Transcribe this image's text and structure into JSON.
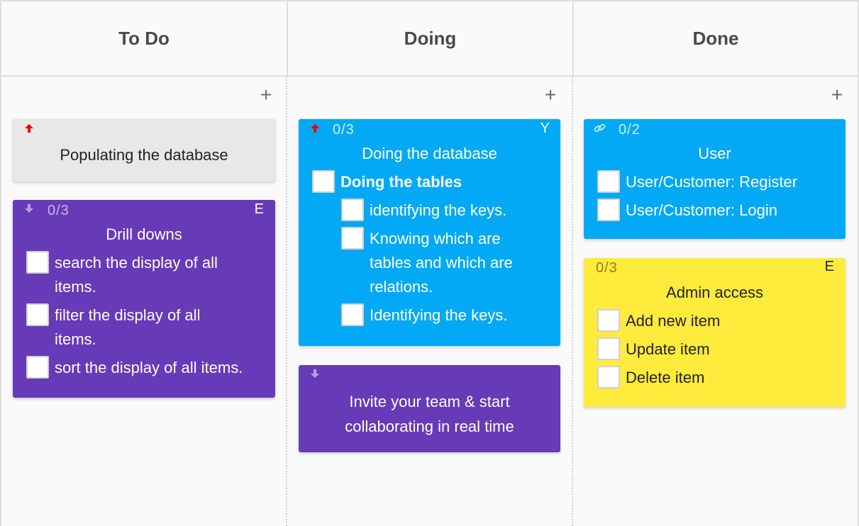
{
  "columns": [
    {
      "title": "To Do",
      "add_label": "+"
    },
    {
      "title": "Doing",
      "add_label": "+"
    },
    {
      "title": "Done",
      "add_label": "+"
    }
  ],
  "cards": {
    "populating": {
      "title": "Populating the database",
      "priority": "high",
      "color": "#e8e8e8"
    },
    "drill": {
      "counter": "0/3",
      "initial": "E",
      "title": "Drill downs",
      "priority": "low",
      "color": "#673ab7",
      "items": [
        "search the display of all items.",
        "filter the display of all items.",
        "sort the display of all items."
      ]
    },
    "doing_db": {
      "counter": "0/3",
      "initial": "Y",
      "title": "Doing the database",
      "priority": "high",
      "color": "#03a9f4",
      "parent_item": "Doing the tables",
      "items": [
        "identifying the keys.",
        "Knowing which are tables and which are relations.",
        "Identifying the keys."
      ]
    },
    "invite": {
      "title": "Invite your team & start collaborating in real time",
      "priority": "low",
      "color": "#673ab7"
    },
    "user": {
      "counter": "0/2",
      "title": "User",
      "icon": "link-icon",
      "color": "#03a9f4",
      "items": [
        "User/Customer: Register",
        "User/Customer: Login"
      ]
    },
    "admin": {
      "counter": "0/3",
      "initial": "E",
      "title": "Admin access",
      "color": "#ffeb3b",
      "items": [
        "Add new item",
        "Update item",
        "Delete item"
      ]
    }
  }
}
